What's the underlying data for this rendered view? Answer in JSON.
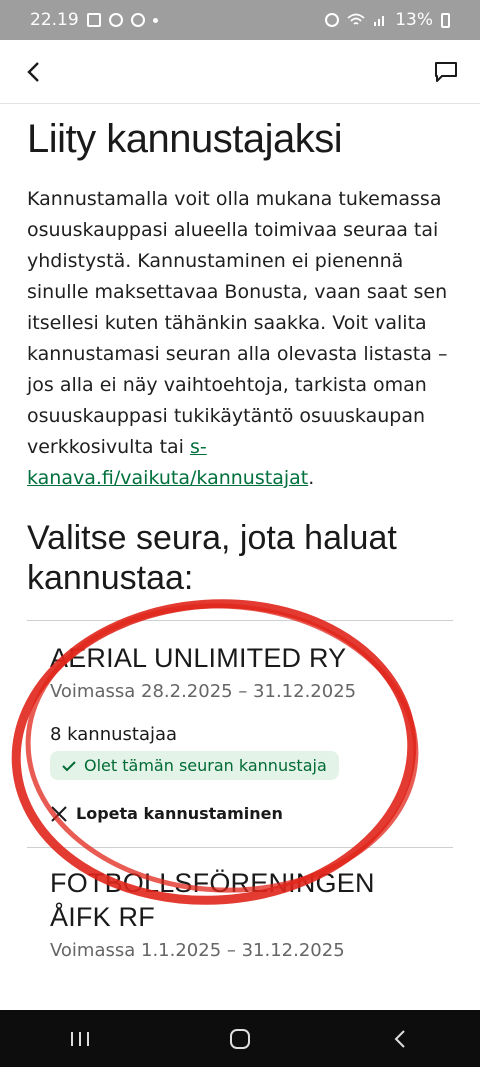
{
  "status_bar": {
    "time": "22.19",
    "battery": "13%"
  },
  "appbar": {
    "back_icon": "chevron-left-icon",
    "chat_icon": "chat-icon"
  },
  "page": {
    "title": "Liity kannustajaksi",
    "intro_text": "Kannustamalla voit olla mukana tukemassa osuuskauppasi alueella toimivaa seuraa tai yhdistystä. Kannustaminen ei pienennä sinulle maksettavaa Bonusta, vaan saat sen itsellesi kuten tähänkin saakka. Voit valita kannustamasi seuran alla olevasta listasta – jos alla ei näy vaihtoehtoja, tarkista oman osuuskauppasi tukikäytäntö osuuskaupan verkkosivulta tai ",
    "intro_link": "s-kanava.fi/vaikuta/kannustajat",
    "intro_end": ".",
    "section_heading": "Valitse seura, jota haluat kannustaa:"
  },
  "clubs": [
    {
      "name": "AERIAL UNLIMITED RY",
      "validity": "Voimassa 28.2.2025 – 31.12.2025",
      "supporters": "8 kannustajaa",
      "status_badge": "Olet tämän seuran kannustaja",
      "stop_label": "Lopeta kannustaminen"
    },
    {
      "name": "FOTBOLLSFÖRENINGEN ÅIFK RF",
      "validity": "Voimassa 1.1.2025 – 31.12.2025"
    }
  ],
  "colors": {
    "link": "#00703c",
    "badge_bg": "#e4f3e8",
    "badge_text": "#006b35",
    "annotation": "#e0261b"
  }
}
